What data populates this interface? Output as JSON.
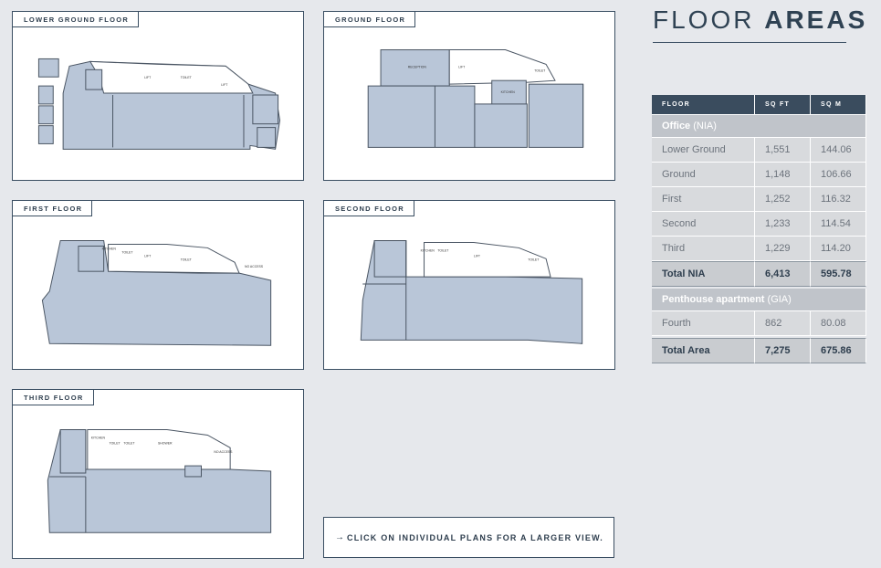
{
  "plans": {
    "lower": {
      "label": "LOWER GROUND FLOOR"
    },
    "ground": {
      "label": "GROUND FLOOR"
    },
    "first": {
      "label": "FIRST FLOOR"
    },
    "second": {
      "label": "SECOND FLOOR"
    },
    "third": {
      "label": "THIRD FLOOR"
    }
  },
  "cta": {
    "arrow": "→",
    "text": "CLICK ON INDIVIDUAL PLANS FOR A LARGER VIEW."
  },
  "floor_areas": {
    "title_light": "FLOOR ",
    "title_bold": "AREAS",
    "headers": [
      "FLOOR",
      "SQ FT",
      "SQ M"
    ],
    "office": {
      "label": "Office",
      "sub": " (NIA)",
      "rows": [
        [
          "Lower Ground",
          "1,551",
          "144.06"
        ],
        [
          "Ground",
          "1,148",
          "106.66"
        ],
        [
          "First",
          "1,252",
          "116.32"
        ],
        [
          "Second",
          "1,233",
          "114.54"
        ],
        [
          "Third",
          "1,229",
          "114.20"
        ]
      ],
      "total": [
        "Total NIA",
        "6,413",
        "595.78"
      ]
    },
    "penthouse": {
      "label": "Penthouse apartment",
      "sub": " (GIA)",
      "rows": [
        [
          "Fourth",
          "862",
          "80.08"
        ]
      ]
    },
    "grand_total": [
      "Total Area",
      "7,275",
      "675.86"
    ]
  },
  "colors": {
    "navy": "#3a4c5e",
    "plan_fill": "#b9c6d8",
    "border": "#3a4e62"
  }
}
